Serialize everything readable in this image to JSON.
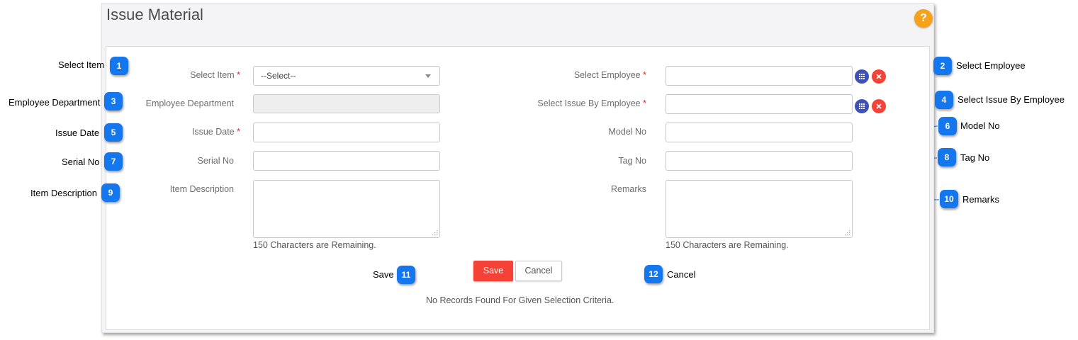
{
  "window": {
    "title": "Issue Material",
    "help_label": "?"
  },
  "form": {
    "select_item": {
      "label": "Select Item",
      "value": "--Select--"
    },
    "employee_department": {
      "label": "Employee Department"
    },
    "issue_date": {
      "label": "Issue Date"
    },
    "serial_no": {
      "label": "Serial No"
    },
    "item_description": {
      "label": "Item Description",
      "remaining": "150  Characters are Remaining."
    },
    "select_employee": {
      "label": "Select Employee"
    },
    "select_issue_by_employee": {
      "label": "Select Issue By Employee"
    },
    "model_no": {
      "label": "Model No"
    },
    "tag_no": {
      "label": "Tag No"
    },
    "remarks": {
      "label": "Remarks",
      "remaining": "150  Characters are Remaining."
    },
    "required_mark": "*"
  },
  "buttons": {
    "save": "Save",
    "cancel": "Cancel"
  },
  "status_message": "No Records Found For Given Selection Criteria.",
  "callouts": [
    {
      "number": "1",
      "label": "Select Item"
    },
    {
      "number": "2",
      "label": "Select Employee"
    },
    {
      "number": "3",
      "label": "Employee Department"
    },
    {
      "number": "4",
      "label": "Select Issue By Employee"
    },
    {
      "number": "5",
      "label": "Issue Date"
    },
    {
      "number": "6",
      "label": "Model No"
    },
    {
      "number": "7",
      "label": "Serial No"
    },
    {
      "number": "8",
      "label": "Tag No"
    },
    {
      "number": "9",
      "label": "Item Description"
    },
    {
      "number": "10",
      "label": "Remarks"
    },
    {
      "number": "11",
      "label": "Save"
    },
    {
      "number": "12",
      "label": "Cancel"
    }
  ],
  "colors": {
    "badge": "#1477ee",
    "save": "#f44336",
    "help": "#f7a21b",
    "lookup": "#3f51b5",
    "clear": "#f44336"
  },
  "icons": {
    "lookup": "grid-icon",
    "clear": "close-icon",
    "help": "question-icon"
  }
}
